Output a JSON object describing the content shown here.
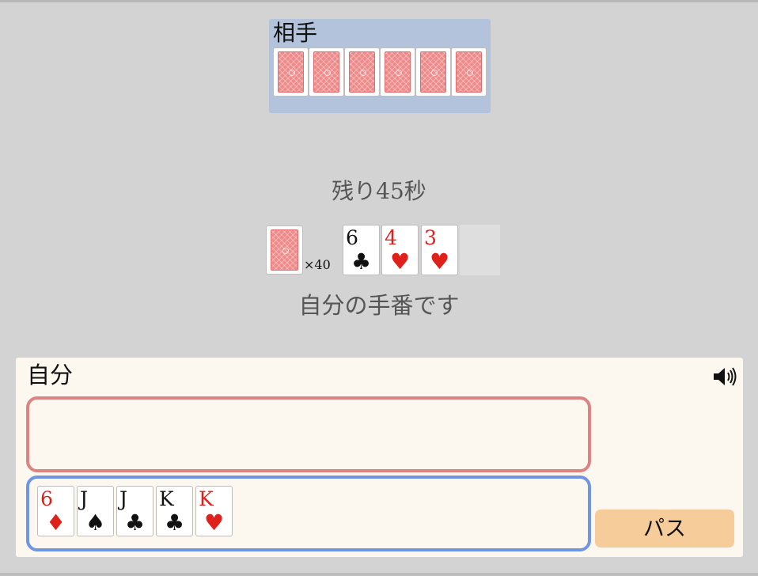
{
  "opponent": {
    "label": "相手",
    "card_count": 6
  },
  "timer": "残り45秒",
  "deck": {
    "count_label": "×40"
  },
  "field": {
    "cards": [
      {
        "rank": "6",
        "suit": "♣",
        "color": "black"
      },
      {
        "rank": "4",
        "suit": "♥",
        "color": "red"
      },
      {
        "rank": "3",
        "suit": "♥",
        "color": "red"
      }
    ]
  },
  "status": "自分の手番です",
  "player": {
    "label": "自分",
    "sound_icon": "speaker-icon",
    "hand": [
      {
        "rank": "6",
        "suit": "♦",
        "color": "red"
      },
      {
        "rank": "J",
        "suit": "♠",
        "color": "black"
      },
      {
        "rank": "J",
        "suit": "♣",
        "color": "black"
      },
      {
        "rank": "K",
        "suit": "♣",
        "color": "black"
      },
      {
        "rank": "K",
        "suit": "♥",
        "color": "red"
      }
    ],
    "pass_label": "パス"
  },
  "colors": {
    "background": "#d3d3d3",
    "opponent_area": "#b3c3db",
    "player_area": "#fdf8ef",
    "play_zone_border": "#de8383",
    "hand_zone_border": "#7095e2",
    "pass_button": "#f5cc9a",
    "red_suit": "#e0201a",
    "card_back": "#ee8a8a"
  }
}
